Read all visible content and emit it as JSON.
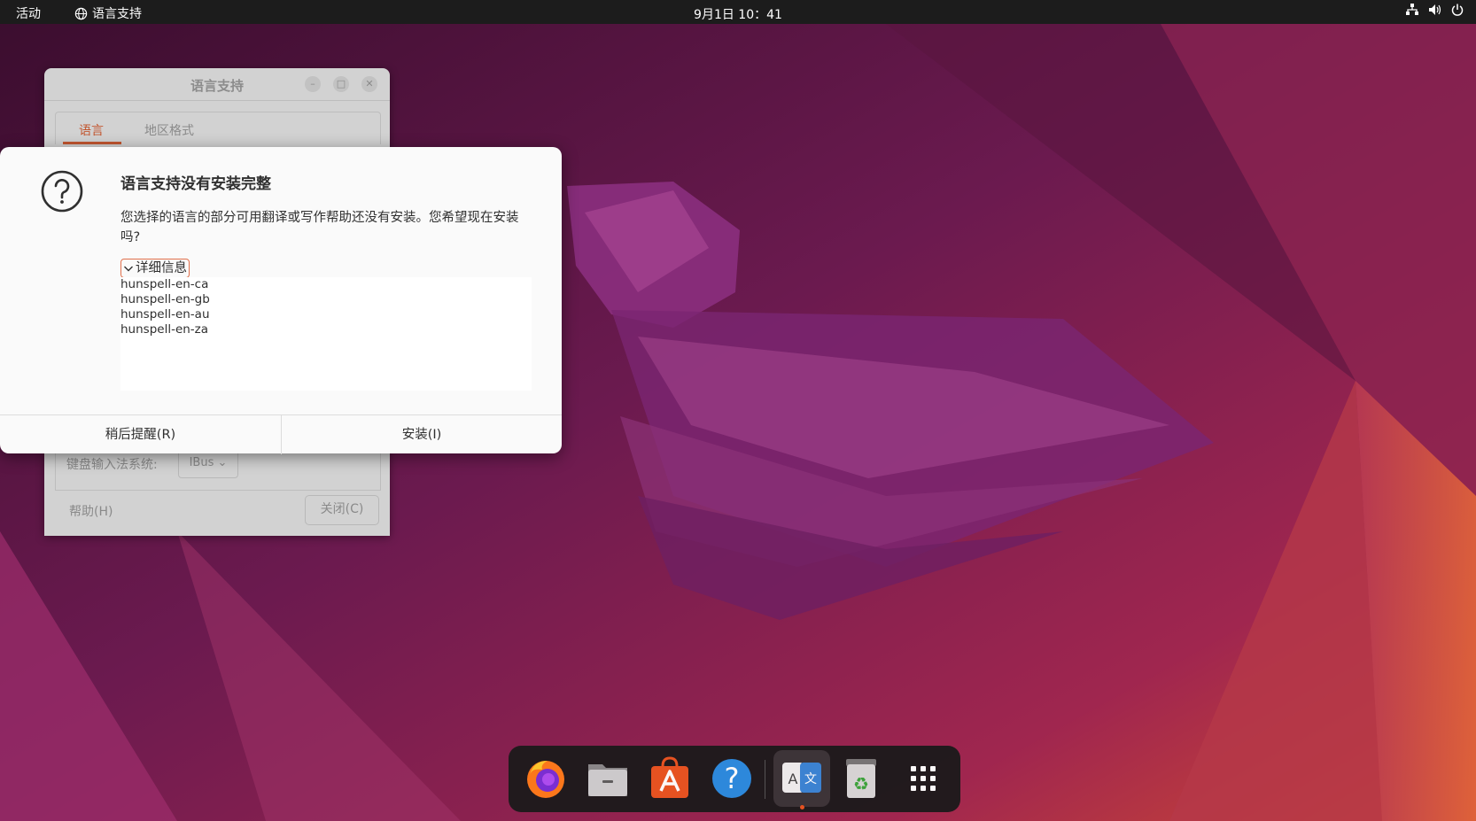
{
  "topbar": {
    "activities": "活动",
    "app_name": "语言支持",
    "clock": "9月1日  10：41"
  },
  "background_window": {
    "title": "语言支持",
    "tabs": [
      "语言",
      "地区格式"
    ],
    "keyboard_label": "键盘输入法系统:",
    "keyboard_value": "IBus",
    "help_button": "帮助(H)",
    "close_button": "关闭(C)"
  },
  "dialog": {
    "heading": "语言支持没有安装完整",
    "message": "您选择的语言的部分可用翻译或写作帮助还没有安装。您希望现在安装吗?",
    "details_label": "详细信息",
    "packages": [
      "hunspell-en-ca",
      "hunspell-en-gb",
      "hunspell-en-au",
      "hunspell-en-za"
    ],
    "remind_button": "稍后提醒(R)",
    "install_button": "安装(I)"
  },
  "dock": {
    "items": [
      "firefox-icon",
      "files-icon",
      "app-center-icon",
      "help-icon",
      "language-support-icon",
      "trash-icon",
      "show-apps-icon"
    ],
    "active_item": "language-support-icon",
    "language_icon_letters": [
      "A",
      "文"
    ]
  },
  "colors": {
    "accent": "#e95420",
    "topbar": "#1c1c1c",
    "wallpaper_base": "#5c1848"
  }
}
